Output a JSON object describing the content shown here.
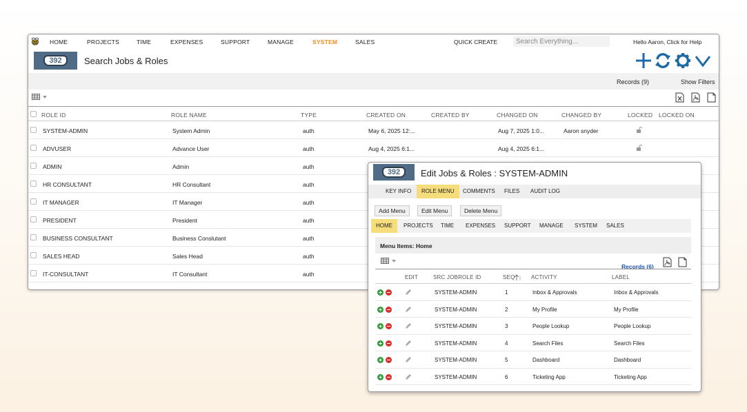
{
  "nav": {
    "items": [
      "HOME",
      "PROJECTS",
      "TIME",
      "EXPENSES",
      "SUPPORT",
      "MANAGE",
      "SYSTEM",
      "SALES"
    ],
    "active": "SYSTEM",
    "quick_create": "QUICK CREATE",
    "search_placeholder": "Search Everything...",
    "hello": "Hello Aaron, Click for Help"
  },
  "logo_text": "392",
  "page_title": "Search Jobs & Roles",
  "records_label": "Records (9)",
  "show_filters": "Show Filters",
  "columns": [
    "ROLE ID",
    "ROLE NAME",
    "TYPE",
    "CREATED ON",
    "CREATED BY",
    "CHANGED ON",
    "CHANGED BY",
    "LOCKED",
    "LOCKED ON"
  ],
  "rows": [
    {
      "role_id": "SYSTEM-ADMIN",
      "role_name": "System Admin",
      "type": "auth",
      "created_on": "May 6, 2025 12:...",
      "created_by": "",
      "changed_on": "Aug 7, 2025 1:0...",
      "changed_by": "Aaron snyder",
      "locked": true
    },
    {
      "role_id": "ADVUSER",
      "role_name": "Advance User",
      "type": "auth",
      "created_on": "Aug 4, 2025 6:1...",
      "created_by": "",
      "changed_on": "Aug 4, 2025 6:1...",
      "changed_by": "",
      "locked": true
    },
    {
      "role_id": "ADMIN",
      "role_name": "Admin",
      "type": "auth"
    },
    {
      "role_id": "HR CONSULTANT",
      "role_name": "HR Consultant",
      "type": "auth"
    },
    {
      "role_id": "IT MANAGER",
      "role_name": "IT Manager",
      "type": "auth"
    },
    {
      "role_id": "PRESIDENT",
      "role_name": "President",
      "type": "auth"
    },
    {
      "role_id": "BUSINESS CONSULTANT",
      "role_name": "Business Conslutant",
      "type": "auth"
    },
    {
      "role_id": "SALES HEAD",
      "role_name": "Sales Head",
      "type": "auth"
    },
    {
      "role_id": "IT-CONSULTANT",
      "role_name": "IT Consultant",
      "type": "auth"
    }
  ],
  "edit": {
    "title": "Edit Jobs & Roles : SYSTEM-ADMIN",
    "tabs": [
      "KEY INFO",
      "ROLE MENU",
      "COMMENTS",
      "FILES",
      "AUDIT LOG"
    ],
    "active_tab": "ROLE MENU",
    "buttons": [
      "Add Menu",
      "Edit Menu",
      "Delete Menu"
    ],
    "subnav": [
      "HOME",
      "PROJECTS",
      "TIME",
      "EXPENSES",
      "SUPPORT",
      "MANAGE",
      "SYSTEM",
      "SALES"
    ],
    "active_sub": "HOME",
    "menu_items_label": "Menu Items: Home",
    "records_label": "Records (6)",
    "columns": [
      "EDIT",
      "SRC JOBROLE ID",
      "SEQ",
      "ACTIVITY",
      "LABEL"
    ],
    "rows": [
      {
        "src": "SYSTEM-ADMIN",
        "seq": "1",
        "activity": "Inbox & Approvals",
        "label": "Inbox & Approvals"
      },
      {
        "src": "SYSTEM-ADMIN",
        "seq": "2",
        "activity": "My Profile",
        "label": "My Profile"
      },
      {
        "src": "SYSTEM-ADMIN",
        "seq": "3",
        "activity": "People Lookup",
        "label": "People Lookup"
      },
      {
        "src": "SYSTEM-ADMIN",
        "seq": "4",
        "activity": "Search Files",
        "label": "Search Files"
      },
      {
        "src": "SYSTEM-ADMIN",
        "seq": "5",
        "activity": "Dashboard",
        "label": "Dashboard"
      },
      {
        "src": "SYSTEM-ADMIN",
        "seq": "6",
        "activity": "Ticketing App",
        "label": "Ticketing App"
      }
    ]
  },
  "colors": {
    "accent": "#f28c1b",
    "brand_blue": "#1c6aa6",
    "tab_active": "#f6dd7c",
    "logo_bg": "#4f6b85"
  }
}
